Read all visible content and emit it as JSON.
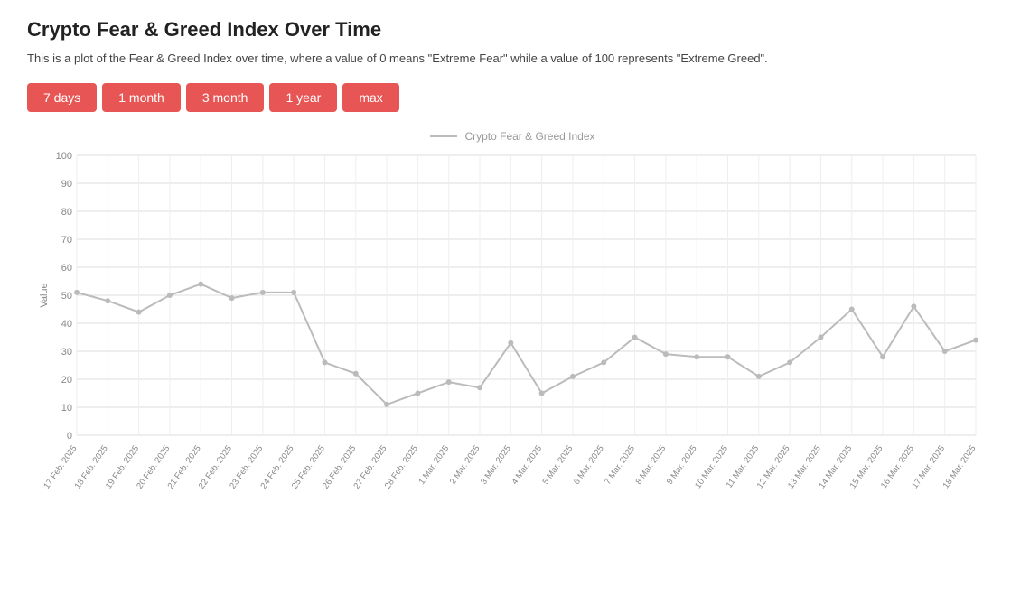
{
  "page": {
    "title": "Crypto Fear & Greed Index Over Time",
    "subtitle": "This is a plot of the Fear & Greed Index over time, where a value of 0 means \"Extreme Fear\" while a value of 100 represents \"Extreme Greed\".",
    "buttons": [
      {
        "label": "7 days",
        "id": "7days"
      },
      {
        "label": "1 month",
        "id": "1month"
      },
      {
        "label": "3 month",
        "id": "3month"
      },
      {
        "label": "1 year",
        "id": "1year"
      },
      {
        "label": "max",
        "id": "max"
      }
    ],
    "chart": {
      "legend_label": "Crypto Fear & Greed Index",
      "y_axis_label": "Value",
      "y_ticks": [
        0,
        10,
        20,
        30,
        40,
        50,
        60,
        70,
        80,
        90,
        100
      ],
      "x_labels": [
        "17 Feb. 2025",
        "18 Feb. 2025",
        "19 Feb. 2025",
        "20 Feb. 2025",
        "21 Feb. 2025",
        "22 Feb. 2025",
        "23 Feb. 2025",
        "24 Feb. 2025",
        "25 Feb. 2025",
        "26 Feb. 2025",
        "27 Feb. 2025",
        "28 Feb. 2025",
        "1 Mar. 2025",
        "2 Mar. 2025",
        "3 Mar. 2025",
        "4 Mar. 2025",
        "5 Mar. 2025",
        "6 Mar. 2025",
        "7 Mar. 2025",
        "8 Mar. 2025",
        "9 Mar. 2025",
        "10 Mar. 2025",
        "11 Mar. 2025",
        "12 Mar. 2025",
        "13 Mar. 2025",
        "14 Mar. 2025",
        "15 Mar. 2025",
        "16 Mar. 2025",
        "17 Mar. 2025",
        "18 Mar. 2025"
      ],
      "data_points": [
        51,
        48,
        44,
        50,
        54,
        49,
        51,
        51,
        26,
        22,
        11,
        15,
        19,
        17,
        33,
        15,
        21,
        26,
        35,
        29,
        28,
        28,
        21,
        26,
        35,
        45,
        28,
        46,
        30,
        34
      ]
    }
  }
}
